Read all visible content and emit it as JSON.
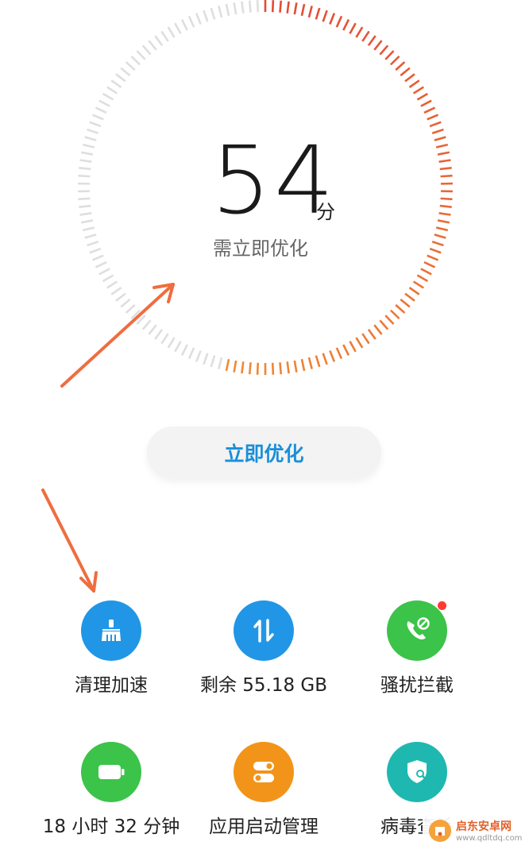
{
  "score": {
    "value": "54",
    "unit": "分",
    "status": "需立即优化",
    "fraction": 0.54,
    "colors": {
      "start": "#e24a36",
      "end": "#ef8a35",
      "track": "#dedede"
    }
  },
  "optimize_button": {
    "label": "立即优化"
  },
  "tools": [
    {
      "label": "清理加速",
      "icon": "broom-icon",
      "color": "#2196e6"
    },
    {
      "label": "剩余 55.18 GB",
      "icon": "transfer-arrows-icon",
      "color": "#2196e6"
    },
    {
      "label": "骚扰拦截",
      "icon": "phone-block-icon",
      "color": "#3cc34a",
      "badge": true
    },
    {
      "label": "18 小时 32 分钟",
      "icon": "battery-icon",
      "color": "#3cc34a"
    },
    {
      "label": "应用启动管理",
      "icon": "toggle-switch-icon",
      "color": "#f29419"
    },
    {
      "label": "病毒查杀",
      "icon": "shield-search-icon",
      "color": "#1fb8b0"
    }
  ],
  "watermark": {
    "name": "启东安卓网",
    "url": "www.qdltdq.com"
  }
}
